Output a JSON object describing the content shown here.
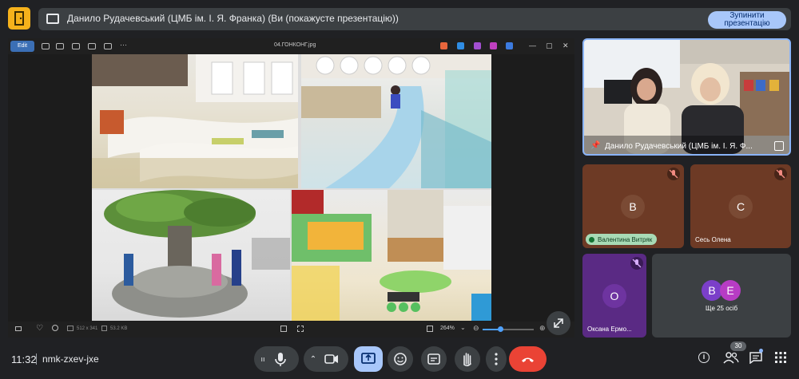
{
  "banner": {
    "text": "Данило Рудачевський (ЦМБ ім. І. Я. Франка) (Ви (покажусте презентацію))",
    "stop_button_line1": "Зупинити",
    "stop_button_line2": "презентацію"
  },
  "photo_viewer": {
    "edit_label": "Edit",
    "file_name": "04.ГОНКОНГ.jpg",
    "dimensions": "512 x 341",
    "file_size": "53.2 KB",
    "zoom": "264%",
    "zoom_level_fraction": 0.35,
    "window_controls": [
      "—",
      "▢",
      "✕"
    ]
  },
  "participants": {
    "presenter_name": "Данило Рудачевський (ЦМБ ім. І. Я. Ф...",
    "tiles": [
      {
        "initial": "B",
        "name": "Валентина Витряк",
        "speaking": true
      },
      {
        "initial": "C",
        "name": "Сесь Олена",
        "speaking": false
      },
      {
        "initial": "O",
        "name": "Оксана Ермо..."
      }
    ],
    "more": {
      "initials": [
        "B",
        "E"
      ],
      "label": "Ще 25 осіб"
    }
  },
  "controls": {
    "time": "11:32",
    "meeting_code": "nmk-zxev-jxe",
    "participant_count": "30"
  },
  "colors": {
    "accent": "#a8c7fa",
    "end_call": "#ea4335",
    "tile_brown": "#6d3a25",
    "tile_purple": "#5a2a84",
    "avatar_purple": "#7b3fc9",
    "avatar_pink": "#b73cc4"
  }
}
